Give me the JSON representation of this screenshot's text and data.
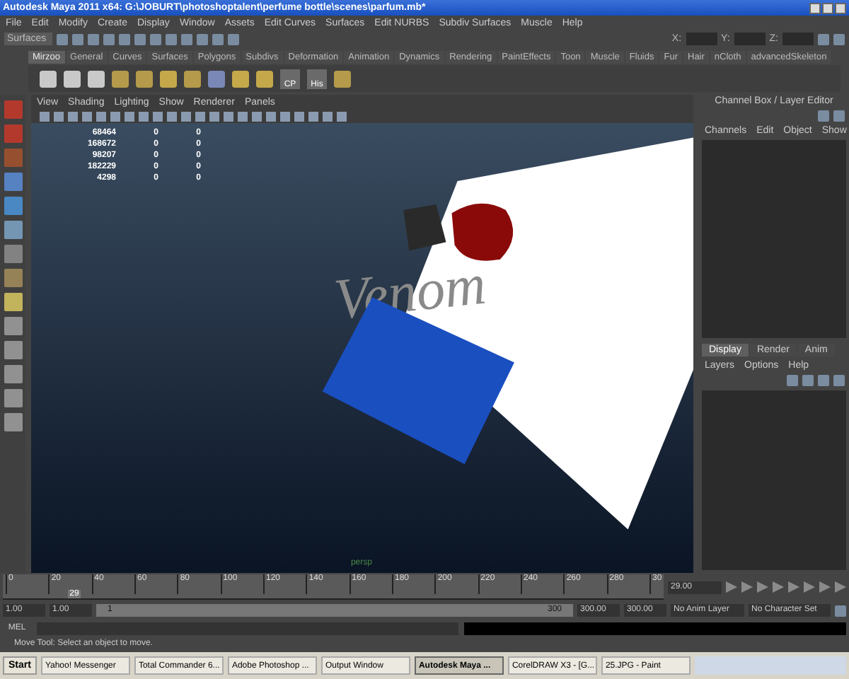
{
  "window": {
    "title": "Autodesk Maya 2011 x64: G:\\JOBURT\\photoshoptalent\\perfume bottle\\scenes\\parfum.mb*"
  },
  "menu": [
    "File",
    "Edit",
    "Modify",
    "Create",
    "Display",
    "Window",
    "Assets",
    "Edit Curves",
    "Surfaces",
    "Edit NURBS",
    "Subdiv Surfaces",
    "Muscle",
    "Help"
  ],
  "status_line": {
    "mode": "Surfaces",
    "coord_labels": [
      "X:",
      "Y:",
      "Z:"
    ]
  },
  "shelf": {
    "tabs": [
      {
        "label": "Mirzoo",
        "selected": true
      },
      {
        "label": "General",
        "selected": false
      },
      {
        "label": "Curves",
        "selected": false
      },
      {
        "label": "Surfaces",
        "selected": false
      },
      {
        "label": "Polygons",
        "selected": false
      },
      {
        "label": "Subdivs",
        "selected": false
      },
      {
        "label": "Deformation",
        "selected": false
      },
      {
        "label": "Animation",
        "selected": false
      },
      {
        "label": "Dynamics",
        "selected": false
      },
      {
        "label": "Rendering",
        "selected": false
      },
      {
        "label": "PaintEffects",
        "selected": false
      },
      {
        "label": "Toon",
        "selected": false
      },
      {
        "label": "Muscle",
        "selected": false
      },
      {
        "label": "Fluids",
        "selected": false
      },
      {
        "label": "Fur",
        "selected": false
      },
      {
        "label": "Hair",
        "selected": false
      },
      {
        "label": "nCloth",
        "selected": false
      },
      {
        "label": "advancedSkeleton",
        "selected": false
      }
    ],
    "icon_labels": [
      "CP",
      "His"
    ]
  },
  "viewport": {
    "menu": [
      "View",
      "Shading",
      "Lighting",
      "Show",
      "Renderer",
      "Panels"
    ],
    "stats": [
      [
        "68464",
        "0",
        "0"
      ],
      [
        "168672",
        "0",
        "0"
      ],
      [
        "98207",
        "0",
        "0"
      ],
      [
        "182229",
        "0",
        "0"
      ],
      [
        "4298",
        "0",
        "0"
      ]
    ],
    "scene_text": "Venom",
    "camera": "persp"
  },
  "channel_box": {
    "title": "Channel Box / Layer Editor",
    "menu": [
      "Channels",
      "Edit",
      "Object",
      "Show"
    ],
    "layer_tabs": [
      {
        "label": "Display",
        "selected": true
      },
      {
        "label": "Render",
        "selected": false
      },
      {
        "label": "Anim",
        "selected": false
      }
    ],
    "layer_menu": [
      "Layers",
      "Options",
      "Help"
    ]
  },
  "timeline": {
    "ticks": [
      "0",
      "20",
      "40",
      "60",
      "80",
      "100",
      "120",
      "140",
      "160",
      "180",
      "200",
      "220",
      "240",
      "260",
      "280",
      "30"
    ],
    "current_frame": "29",
    "level": 0.097,
    "frame_field": "29.00"
  },
  "range": {
    "start": "1.00",
    "inner_start": "1.00",
    "slider_start": "1",
    "slider_end": "300",
    "level": 1,
    "inner_end": "300.00",
    "end": "300.00",
    "anim_layer": "No Anim Layer",
    "character_set": "No Character Set"
  },
  "command": {
    "label": "MEL"
  },
  "help_line": "Move Tool: Select an object to move.",
  "taskbar": {
    "start": "Start",
    "tasks": [
      {
        "label": "Yahoo! Messenger",
        "selected": false
      },
      {
        "label": "Total Commander 6...",
        "selected": false
      },
      {
        "label": "Adobe Photoshop ...",
        "selected": false
      },
      {
        "label": "Output Window",
        "selected": false
      },
      {
        "label": "Autodesk Maya ...",
        "selected": true
      },
      {
        "label": "CorelDRAW X3 - [G...",
        "selected": false
      },
      {
        "label": "25.JPG - Paint",
        "selected": false
      }
    ]
  }
}
